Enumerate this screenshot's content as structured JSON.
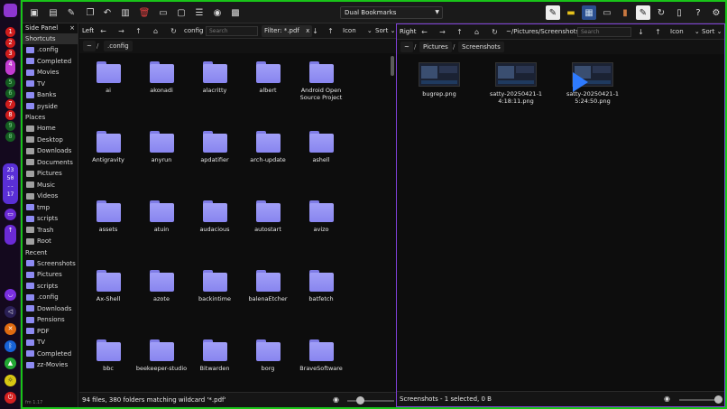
{
  "dock": {
    "workspaces": [
      "1",
      "2",
      "3",
      "4",
      "5",
      "6",
      "7",
      "8",
      "9",
      "0"
    ],
    "clock_lines": [
      "23",
      "50",
      "--",
      "17"
    ]
  },
  "toolbar": {
    "bookmarks_label": "Dual Bookmarks"
  },
  "side_panel": {
    "title": "Side Panel",
    "footer": "fm 1.17",
    "sections": [
      {
        "label": "Shortcuts",
        "items": [
          ".config",
          "Completed",
          "Movies",
          "TV",
          "Banks",
          "pyside"
        ]
      },
      {
        "label": "Places",
        "items": [
          "Home",
          "Desktop",
          "Downloads",
          "Documents",
          "Pictures",
          "Music",
          "Videos",
          "tmp",
          "scripts",
          "Trash",
          "Root"
        ]
      },
      {
        "label": "Recent",
        "items": [
          "Screenshots",
          "Pictures",
          "scripts",
          ".config",
          "Downloads",
          "Pensions",
          "PDF",
          "TV",
          "Completed",
          "zz-Movies"
        ]
      }
    ]
  },
  "left_pane": {
    "label": "Left",
    "path": "config",
    "search_placeholder": "Search",
    "filter": "Filter: *.pdf",
    "filter_clear": "x",
    "view_mode": "Icon",
    "sort": "Sort",
    "crumbs": [
      "~",
      "/",
      ".config"
    ],
    "status": "94 files, 380 folders matching wildcard '*.pdf'",
    "items": [
      "ai",
      "akonadi",
      "alacritty",
      "albert",
      "Android Open Source Project",
      "Antigravity",
      "anyrun",
      "apdatifier",
      "arch-update",
      "ashell",
      "assets",
      "atuin",
      "audacious",
      "autostart",
      "avizo",
      "Ax-Shell",
      "azote",
      "backintime",
      "balenaEtcher",
      "batfetch",
      "bbc",
      "beekeeper-studio",
      "Bitwarden",
      "borg",
      "BraveSoftware"
    ]
  },
  "right_pane": {
    "label": "Right",
    "path": "~/Pictures/Screenshots",
    "search_placeholder": "Search",
    "view_mode": "Icon",
    "sort": "Sort",
    "crumbs": [
      "~",
      "/",
      "Pictures",
      "/",
      "Screenshots"
    ],
    "status": "Screenshots - 1 selected, 0 B",
    "items": [
      "bugrep.png",
      "satty-20250421-14:18:11.png",
      "satty-20250421-15:24:50.png"
    ]
  }
}
